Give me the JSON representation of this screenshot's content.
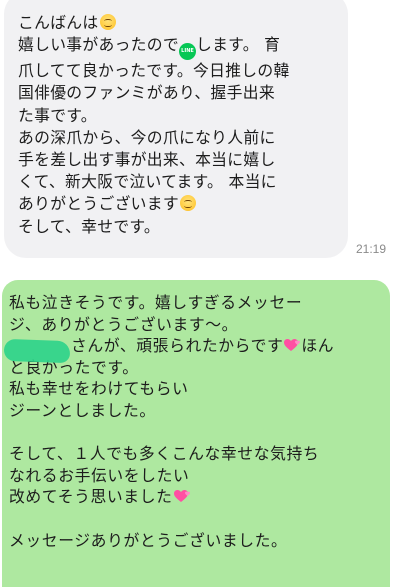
{
  "received_message": {
    "greeting": "こんばんは",
    "line2_before": "嬉しい事があったので",
    "line2_icon_text": "LINE",
    "line2_after": "します。 育",
    "line3": "爪してて良かったです。今日推しの韓",
    "line4": "国俳優のファンミがあり、握手出来",
    "line5": "た事です。",
    "line6": "あの深爪から、今の爪になり人前に",
    "line7": "手を差し出す事が出来、本当に嬉し",
    "line8": "くて、新大阪で泣いてます。 本当に",
    "line9": "ありがとうございます",
    "line10": "そして、幸せです。",
    "time": "21:19"
  },
  "sent_message": {
    "line1": "私も泣きそうです。嬉しすぎるメッセー",
    "line2": "ジ、ありがとうございます〜。",
    "line3_before": "さんが、頑張られたからです",
    "line3_after": "ほん",
    "line4": "と良かったです。",
    "line5": "私も幸せをわけてもらい",
    "line6": "ジーンとしました。",
    "line7": "そして、１人でも多くこんな幸せな気持ち",
    "line8": "なれるお手伝いをしたい",
    "line9": "改めてそう思いました",
    "line10": "メッセージありがとうございました。"
  },
  "colors": {
    "received_bubble": "#f1f1f3",
    "sent_bubble": "#aee8a0",
    "redaction": "#2fd28a",
    "line_icon": "#06c755"
  },
  "icons": {
    "smile": "smiling-face-emoji",
    "line_logo": "line-app-icon",
    "heart": "two-hearts-emoji"
  }
}
